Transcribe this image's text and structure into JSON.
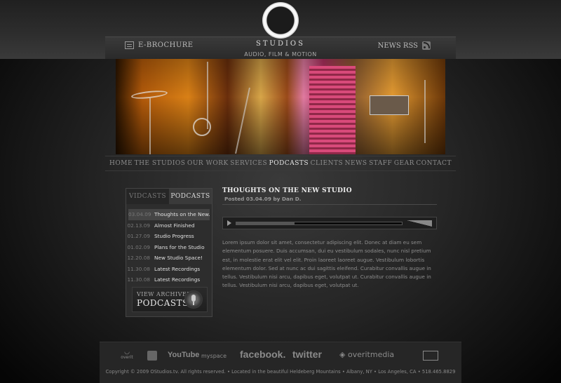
{
  "brand": {
    "name": "STUDIOS",
    "tagline": "AUDIO, FILM & MOTION"
  },
  "header": {
    "ebrochure_label": "E-BROCHURE",
    "news_rss_label": "NEWS RSS"
  },
  "nav": {
    "items": [
      {
        "label": "HOME"
      },
      {
        "label": "THE STUDIOS"
      },
      {
        "label": "OUR WORK"
      },
      {
        "label": "SERVICES"
      },
      {
        "label": "PODCASTS",
        "active": true
      },
      {
        "label": "CLIENTS"
      },
      {
        "label": "NEWS"
      },
      {
        "label": "STAFF"
      },
      {
        "label": "GEAR"
      },
      {
        "label": "CONTACT"
      }
    ]
  },
  "sidebar": {
    "tabs": [
      {
        "label": "VIDCASTS",
        "active": false
      },
      {
        "label": "PODCASTS",
        "active": true
      }
    ],
    "podcasts": [
      {
        "date": "03.04.09",
        "title": "Thoughts on the New...",
        "selected": true
      },
      {
        "date": "02.13.09",
        "title": "Almost Finished"
      },
      {
        "date": "01.27.09",
        "title": "Studio Progress"
      },
      {
        "date": "01.02.09",
        "title": "Plans for the Studio"
      },
      {
        "date": "12.20.08",
        "title": "New Studio Space!"
      },
      {
        "date": "11.30.08",
        "title": "Latest Recordings"
      },
      {
        "date": "11.30.08",
        "title": "Latest Recordings"
      }
    ],
    "archive": {
      "line1": "VIEW ARCHIVED",
      "line2": "PODCASTS"
    }
  },
  "post": {
    "title": "THOUGHTS ON THE NEW STUDIO",
    "meta": "Posted 03.04.09 by Dan D.",
    "player_progress": 0.35,
    "body": "Lorem ipsum dolor sit amet, consectetur adipiscing elit. Donec at diam eu sem elementum posuere. Duis accumsan, dui eu vestibulum sodales, nunc nisl pretium est, in molestie erat elit vel elit. Proin laoreet laoreet augue. Vestibulum lobortis elementum dolor. Sed at nunc ac dui sagittis eleifend. Curabitur convallis augue in tellus. Vestibulum nisi arcu, dapibus eget, volutpat ut. Curabitur convallis augue in tellus. Vestibulum nisi arcu, dapibus eget, volutpat ut."
  },
  "footer": {
    "links": {
      "overit_small": "overit",
      "youtube": "YouTube",
      "myspace": "myspace",
      "facebook": "facebook.",
      "twitter": "twitter",
      "overitmedia": "overitmedia"
    },
    "copyright": "Copyright © 2009 OStudios.tv. All rights reserved. • Located in the beautiful Heldeberg Mountains • Albany, NY • Los Angeles, CA • 518.465.8829"
  }
}
